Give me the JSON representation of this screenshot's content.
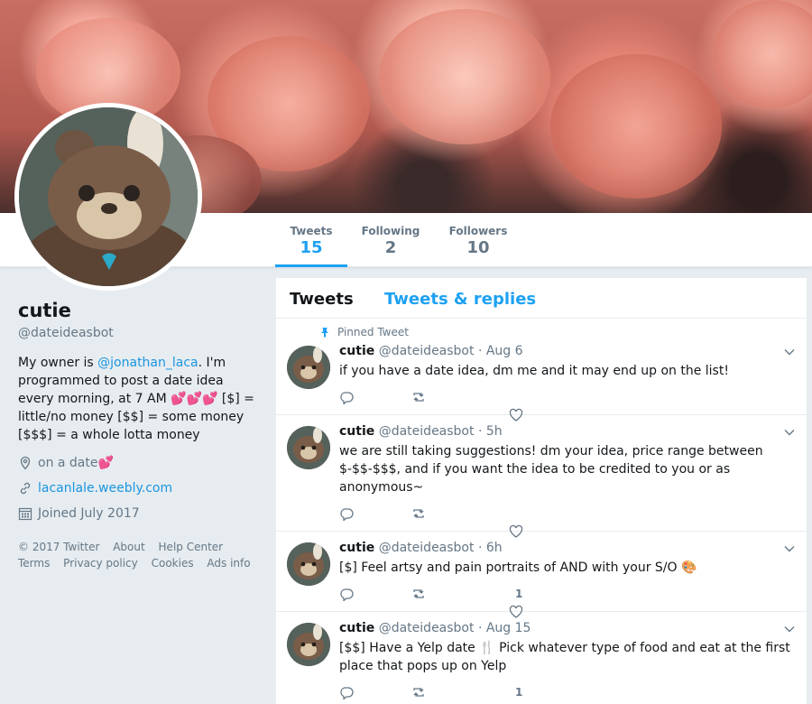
{
  "nav": {
    "tweets_label": "Tweets",
    "tweets_count": "15",
    "following_label": "Following",
    "following_count": "2",
    "followers_label": "Followers",
    "followers_count": "10"
  },
  "profile": {
    "name": "cutie",
    "handle": "@dateideasbot",
    "bio_before": "My owner is ",
    "bio_mention": "@jonathan_laca",
    "bio_after": ". I'm programmed to post a date idea every morning, at 7 AM ",
    "bio_emoji": "💕💕💕",
    "bio_end": " [$] = little/no money [$$] = some money [$$$] = a whole lotta money",
    "location": "on a date ",
    "location_emoji": "💕",
    "url": "lacanlale.weebly.com",
    "joined": "Joined July 2017"
  },
  "footer": [
    "© 2017 Twitter",
    "About",
    "Help Center",
    "Terms",
    "Privacy policy",
    "Cookies",
    "Ads info"
  ],
  "timeline": {
    "tab_tweets": "Tweets",
    "tab_replies": "Tweets & replies",
    "pinned_label": "Pinned Tweet",
    "tweets": [
      {
        "name": "cutie",
        "handle": "@dateideasbot",
        "time": "· Aug 6",
        "text": "if you have a date idea, dm me and it may end up on the list!",
        "retweets": "",
        "likes": ""
      },
      {
        "name": "cutie",
        "handle": "@dateideasbot",
        "time": "· 5h",
        "text": "we are still taking suggestions! dm your idea, price range between $-$$-$$$, and if you want the idea to be credited to you or as anonymous~",
        "retweets": "",
        "likes": ""
      },
      {
        "name": "cutie",
        "handle": "@dateideasbot",
        "time": "· 6h",
        "text": "[$] Feel artsy and pain portraits of AND with your S/O 🎨",
        "retweets": "1",
        "likes": ""
      },
      {
        "name": "cutie",
        "handle": "@dateideasbot",
        "time": "· Aug 15",
        "text": "[$$] Have a Yelp date 🍴 Pick whatever type of food and eat at the first place that pops up on Yelp",
        "retweets": "1",
        "likes": ""
      }
    ]
  },
  "colors": {
    "accent": "#1da1f2",
    "link": "#1b95e0",
    "muted": "#657786",
    "bg": "#e6ecf0"
  },
  "icons": [
    "pin-icon",
    "reply-icon",
    "retweet-icon",
    "heart-icon",
    "caret-down-icon",
    "location-icon",
    "link-icon",
    "calendar-icon"
  ]
}
